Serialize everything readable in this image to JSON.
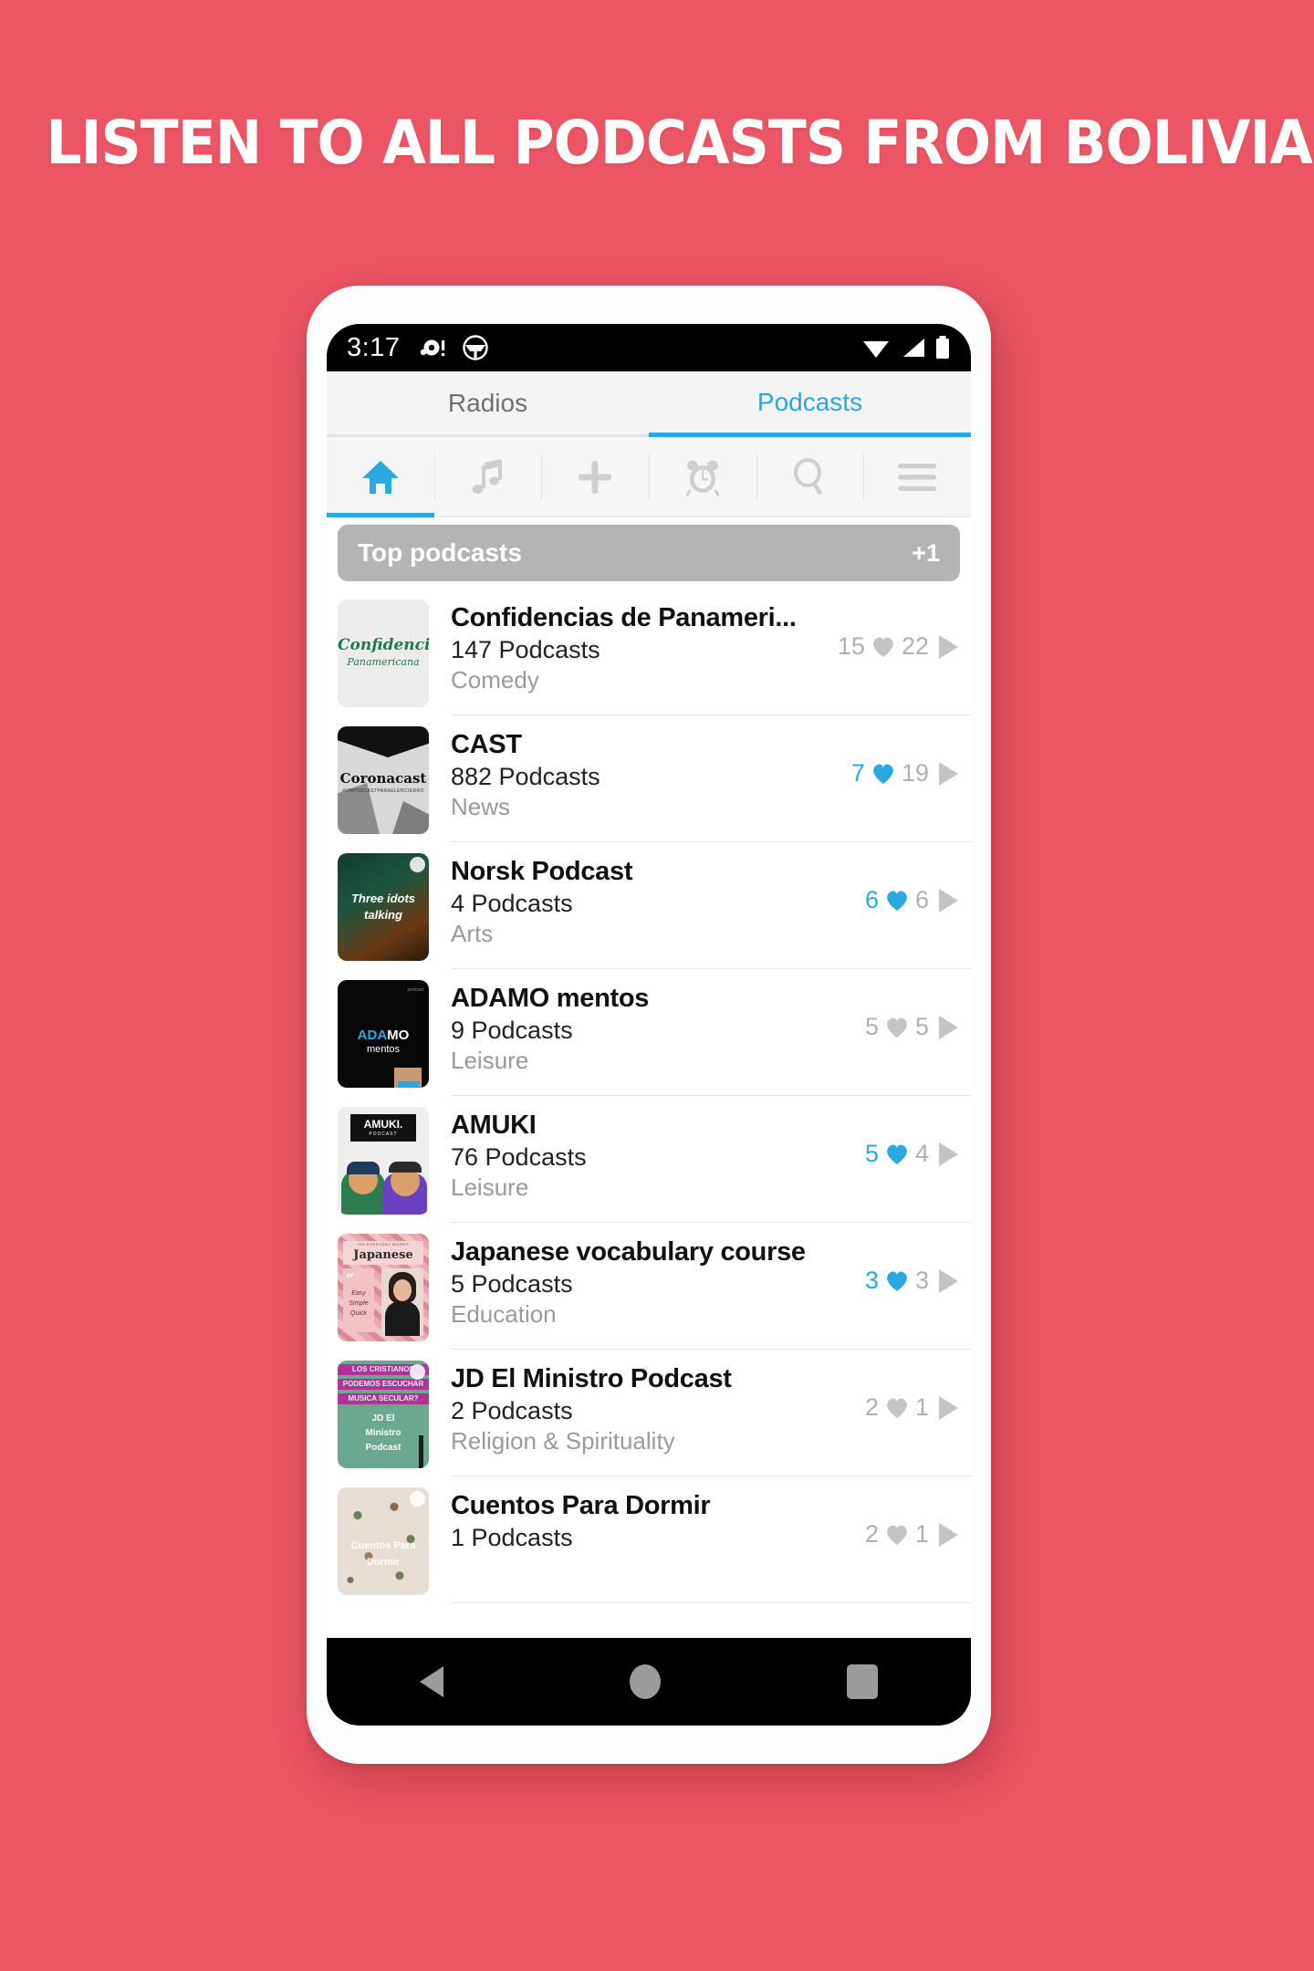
{
  "headline": "LISTEN TO ALL PODCASTS FROM BOLIVIA",
  "colors": {
    "background": "#eb5564",
    "accent": "#2aa8e0",
    "section_bar": "#b4b4b4",
    "muted": "#b0b0b0"
  },
  "status_bar": {
    "time": "3:17",
    "left_icons": [
      "alert-dot-icon",
      "steering-wheel-icon"
    ],
    "right_icons": [
      "wifi-icon",
      "signal-icon",
      "battery-icon"
    ]
  },
  "tabs": [
    {
      "label": "Radios",
      "active": false
    },
    {
      "label": "Podcasts",
      "active": true
    }
  ],
  "toolbar": [
    {
      "icon": "home-icon",
      "active": true
    },
    {
      "icon": "music-note-icon",
      "active": false
    },
    {
      "icon": "plus-icon",
      "active": false
    },
    {
      "icon": "alarm-clock-icon",
      "active": false
    },
    {
      "icon": "search-icon",
      "active": false
    },
    {
      "icon": "hamburger-menu-icon",
      "active": false
    }
  ],
  "section": {
    "title": "Top podcasts",
    "extra": "+1"
  },
  "podcasts": [
    {
      "title": "Confidencias de Panameri...",
      "count": "147 Podcasts",
      "category": "Comedy",
      "likes": "15",
      "plays": "22",
      "liked": false,
      "thumb_text": "Confidencias Panamericana"
    },
    {
      "title": "CAST",
      "count": "882 Podcasts",
      "category": "News",
      "likes": "7",
      "plays": "19",
      "liked": true,
      "thumb_text": "Coronacast"
    },
    {
      "title": "Norsk Podcast",
      "count": "4 Podcasts",
      "category": "Arts",
      "likes": "6",
      "plays": "6",
      "liked": true,
      "thumb_text": "Three idots talking"
    },
    {
      "title": "ADAMO mentos",
      "count": "9 Podcasts",
      "category": "Leisure",
      "likes": "5",
      "plays": "5",
      "liked": false,
      "thumb_text": "ADAMO mentos"
    },
    {
      "title": "AMUKI",
      "count": "76 Podcasts",
      "category": "Leisure",
      "likes": "5",
      "plays": "4",
      "liked": true,
      "thumb_text": "AMUKI PODCAST"
    },
    {
      "title": "Japanese vocabulary course",
      "count": "5 Podcasts",
      "category": "Education",
      "likes": "3",
      "plays": "3",
      "liked": true,
      "thumb_text": "Japanese Easy Simple Quick"
    },
    {
      "title": "JD El Ministro Podcast",
      "count": "2 Podcasts",
      "category": "Religion & Spirituality",
      "likes": "2",
      "plays": "1",
      "liked": false,
      "thumb_text": "JD El Ministro Podcast"
    },
    {
      "title": "Cuentos Para Dormir",
      "count": "1 Podcasts",
      "category": "",
      "likes": "2",
      "plays": "1",
      "liked": false,
      "thumb_text": "Cuentos Para Dormir"
    }
  ],
  "nav_bar": {
    "back": "back-triangle-icon",
    "home": "home-circle-icon",
    "recents": "recents-square-icon"
  }
}
